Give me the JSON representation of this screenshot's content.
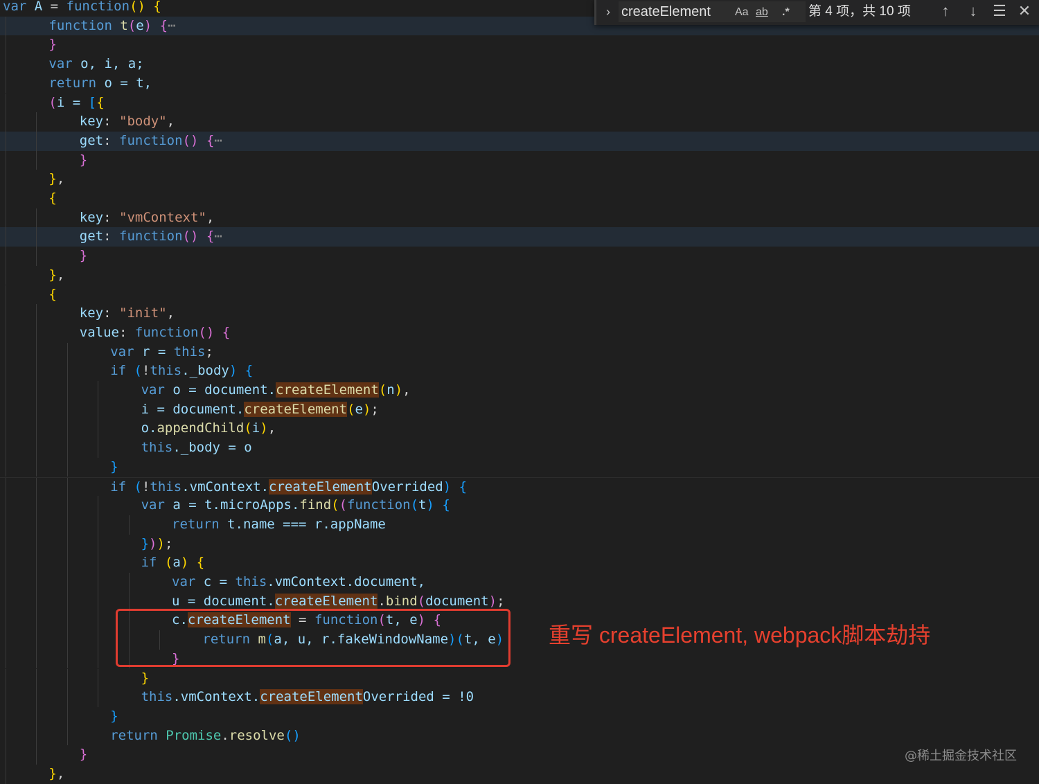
{
  "find_widget": {
    "query": "createElement",
    "match_case_label": "Aa",
    "whole_word_label": "ab",
    "regex_label": ".*",
    "match_count": "第 4 项，共 10 项",
    "prev_icon": "arrow-up-icon",
    "next_icon": "arrow-down-icon",
    "selection_icon": "find-in-selection-icon",
    "close_icon": "close-icon",
    "toggle_icon": "chevron-right-icon"
  },
  "annotation": "重写 createElement, webpack脚本劫持",
  "watermark": "@稀土掘金技术社区",
  "colors": {
    "background": "#1f1f1f",
    "keyword": "#569cd6",
    "function": "#dcdcaa",
    "variable": "#9cdcfe",
    "string": "#ce9178",
    "match_highlight": "#613214",
    "annotation_red": "#e5402e"
  },
  "code_lines": [
    {
      "tokens": [
        [
          "var",
          "kw"
        ],
        [
          " A ",
          "var"
        ],
        [
          "= ",
          "pun"
        ],
        [
          "function",
          "kw"
        ],
        [
          "() ",
          "b1"
        ],
        [
          "{",
          "b1"
        ]
      ]
    },
    {
      "tokens": [
        [
          "function ",
          "kw"
        ],
        [
          "t",
          "fn"
        ],
        [
          "(",
          "b2"
        ],
        [
          "e",
          "var"
        ],
        [
          ")",
          "b2"
        ],
        [
          " ",
          "pun"
        ],
        [
          "{",
          "b2"
        ],
        [
          "⋯",
          "ell"
        ]
      ]
    },
    {
      "tokens": [
        [
          "}",
          "b2"
        ]
      ]
    },
    {
      "tokens": [
        [
          "var ",
          "kw"
        ],
        [
          "o, i, a;",
          "var"
        ]
      ]
    },
    {
      "tokens": [
        [
          "return ",
          "kw"
        ],
        [
          "o = t,",
          "var"
        ]
      ]
    },
    {
      "tokens": [
        [
          "(",
          "b2"
        ],
        [
          "i = ",
          "var"
        ],
        [
          "[",
          "b3"
        ],
        [
          "{",
          "b1"
        ]
      ]
    },
    {
      "tokens": [
        [
          "key",
          "var"
        ],
        [
          ": ",
          "pun"
        ],
        [
          "\"body\"",
          "str"
        ],
        [
          ",",
          "pun"
        ]
      ]
    },
    {
      "tokens": [
        [
          "get",
          "var"
        ],
        [
          ": ",
          "pun"
        ],
        [
          "function",
          "kw"
        ],
        [
          "() ",
          "b2"
        ],
        [
          "{",
          "b2"
        ],
        [
          "⋯",
          "ell"
        ]
      ]
    },
    {
      "tokens": [
        [
          "}",
          "b2"
        ]
      ]
    },
    {
      "tokens": [
        [
          "}",
          "b1"
        ],
        [
          ",",
          "pun"
        ]
      ]
    },
    {
      "tokens": [
        [
          "{",
          "b1"
        ]
      ]
    },
    {
      "tokens": [
        [
          "key",
          "var"
        ],
        [
          ": ",
          "pun"
        ],
        [
          "\"vmContext\"",
          "str"
        ],
        [
          ",",
          "pun"
        ]
      ]
    },
    {
      "tokens": [
        [
          "get",
          "var"
        ],
        [
          ": ",
          "pun"
        ],
        [
          "function",
          "kw"
        ],
        [
          "() ",
          "b2"
        ],
        [
          "{",
          "b2"
        ],
        [
          "⋯",
          "ell"
        ]
      ]
    },
    {
      "tokens": [
        [
          "}",
          "b2"
        ]
      ]
    },
    {
      "tokens": [
        [
          "}",
          "b1"
        ],
        [
          ",",
          "pun"
        ]
      ]
    },
    {
      "tokens": [
        [
          "{",
          "b1"
        ]
      ]
    },
    {
      "tokens": [
        [
          "key",
          "var"
        ],
        [
          ": ",
          "pun"
        ],
        [
          "\"init\"",
          "str"
        ],
        [
          ",",
          "pun"
        ]
      ]
    },
    {
      "tokens": [
        [
          "value",
          "var"
        ],
        [
          ": ",
          "pun"
        ],
        [
          "function",
          "kw"
        ],
        [
          "() ",
          "b2"
        ],
        [
          "{",
          "b2"
        ]
      ]
    },
    {
      "tokens": [
        [
          "var ",
          "kw"
        ],
        [
          "r = ",
          "var"
        ],
        [
          "this",
          "kw"
        ],
        [
          ";",
          "pun"
        ]
      ]
    },
    {
      "tokens": [
        [
          "if ",
          "kw"
        ],
        [
          "(",
          "b3"
        ],
        [
          "!",
          "pun"
        ],
        [
          "this",
          "kw"
        ],
        [
          "._body",
          "var"
        ],
        [
          ") ",
          "b3"
        ],
        [
          "{",
          "b3"
        ]
      ]
    },
    {
      "tokens": [
        [
          "var ",
          "kw"
        ],
        [
          "o = document.",
          "var"
        ],
        [
          "createElement",
          "fn match"
        ],
        [
          "(",
          "b1"
        ],
        [
          "n",
          "var"
        ],
        [
          ")",
          "b1"
        ],
        [
          ",",
          "pun"
        ]
      ]
    },
    {
      "tokens": [
        [
          "i = document.",
          "var"
        ],
        [
          "createElement",
          "fn match"
        ],
        [
          "(",
          "b1"
        ],
        [
          "e",
          "var"
        ],
        [
          ")",
          "b1"
        ],
        [
          ";",
          "pun"
        ]
      ]
    },
    {
      "tokens": [
        [
          "o.",
          "var"
        ],
        [
          "appendChild",
          "fn"
        ],
        [
          "(",
          "b1"
        ],
        [
          "i",
          "var"
        ],
        [
          ")",
          "b1"
        ],
        [
          ",",
          "pun"
        ]
      ]
    },
    {
      "tokens": [
        [
          "this",
          "kw"
        ],
        [
          "._body = o",
          "var"
        ]
      ]
    },
    {
      "tokens": [
        [
          "}",
          "b3"
        ]
      ]
    },
    {
      "tokens": [
        [
          "if ",
          "kw"
        ],
        [
          "(",
          "b3"
        ],
        [
          "!",
          "pun"
        ],
        [
          "this",
          "kw"
        ],
        [
          ".vmContext.",
          "var"
        ],
        [
          "createElement",
          "var match"
        ],
        [
          "Overrided",
          "var"
        ],
        [
          ") ",
          "b3"
        ],
        [
          "{",
          "b3"
        ]
      ]
    },
    {
      "tokens": [
        [
          "var ",
          "kw"
        ],
        [
          "a = t.microApps.",
          "var"
        ],
        [
          "find",
          "fn"
        ],
        [
          "(",
          "b1"
        ],
        [
          "(",
          "b2"
        ],
        [
          "function",
          "kw"
        ],
        [
          "(",
          "b3"
        ],
        [
          "t",
          "var"
        ],
        [
          ") ",
          "b3"
        ],
        [
          "{",
          "b3"
        ]
      ]
    },
    {
      "tokens": [
        [
          "return ",
          "kw"
        ],
        [
          "t.name === r.appName",
          "var"
        ]
      ]
    },
    {
      "tokens": [
        [
          "}",
          "b3"
        ],
        [
          ")",
          "b2"
        ],
        [
          ")",
          "b1"
        ],
        [
          ";",
          "pun"
        ]
      ]
    },
    {
      "tokens": [
        [
          "if ",
          "kw"
        ],
        [
          "(",
          "b1"
        ],
        [
          "a",
          "var"
        ],
        [
          ") ",
          "b1"
        ],
        [
          "{",
          "b1"
        ]
      ]
    },
    {
      "tokens": [
        [
          "var ",
          "kw"
        ],
        [
          "c = ",
          "var"
        ],
        [
          "this",
          "kw"
        ],
        [
          ".vmContext.document,",
          "var"
        ]
      ]
    },
    {
      "tokens": [
        [
          "u = document.",
          "var"
        ],
        [
          "createElement",
          "var match"
        ],
        [
          ".",
          "pun"
        ],
        [
          "bind",
          "fn"
        ],
        [
          "(",
          "b2"
        ],
        [
          "document",
          "var"
        ],
        [
          ")",
          "b2"
        ],
        [
          ";",
          "pun"
        ]
      ]
    },
    {
      "tokens": [
        [
          "c.",
          "var"
        ],
        [
          "createElement",
          "var match"
        ],
        [
          " = ",
          "pun"
        ],
        [
          "function",
          "kw"
        ],
        [
          "(",
          "b2"
        ],
        [
          "t, e",
          "var"
        ],
        [
          ") ",
          "b2"
        ],
        [
          "{",
          "b2"
        ]
      ]
    },
    {
      "tokens": [
        [
          "return ",
          "kw"
        ],
        [
          "m",
          "fn"
        ],
        [
          "(",
          "b3"
        ],
        [
          "a, u, r.fakeWindowName",
          "var"
        ],
        [
          ")",
          "b3"
        ],
        [
          "(",
          "b3"
        ],
        [
          "t, e",
          "var"
        ],
        [
          ")",
          "b3"
        ]
      ]
    },
    {
      "tokens": [
        [
          "}",
          "b2"
        ]
      ]
    },
    {
      "tokens": [
        [
          "}",
          "b1"
        ]
      ]
    },
    {
      "tokens": [
        [
          "this",
          "kw"
        ],
        [
          ".vmContext.",
          "var"
        ],
        [
          "createElement",
          "var match"
        ],
        [
          "Overrided = !0",
          "var"
        ]
      ]
    },
    {
      "tokens": [
        [
          "}",
          "b3"
        ]
      ]
    },
    {
      "tokens": [
        [
          "return ",
          "kw"
        ],
        [
          "Promise",
          "cls"
        ],
        [
          ".",
          "pun"
        ],
        [
          "resolve",
          "fn"
        ],
        [
          "()",
          "b3"
        ]
      ]
    },
    {
      "tokens": [
        [
          "}",
          "b2"
        ]
      ]
    },
    {
      "tokens": [
        [
          "}",
          "b1"
        ],
        [
          ",",
          "pun"
        ]
      ]
    }
  ]
}
